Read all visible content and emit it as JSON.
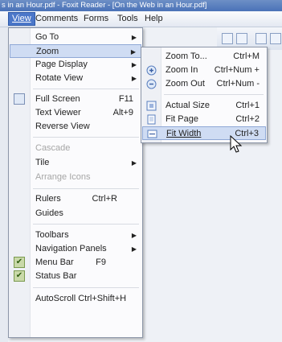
{
  "window": {
    "title": "s in an Hour.pdf - Foxit Reader - [On the Web in an Hour.pdf]"
  },
  "menubar": {
    "items": [
      {
        "label": "View",
        "active": true
      },
      {
        "label": "Comments"
      },
      {
        "label": "Forms"
      },
      {
        "label": "Tools"
      },
      {
        "label": "Help"
      }
    ]
  },
  "view_menu": {
    "items": [
      {
        "label": "Go To",
        "submenu": true
      },
      {
        "label": "Zoom",
        "submenu": true,
        "highlighted": true
      },
      {
        "label": "Page Display",
        "submenu": true
      },
      {
        "label": "Rotate View",
        "submenu": true
      },
      {
        "label": "Full Screen",
        "shortcut": "F11",
        "icon": "full-screen-icon"
      },
      {
        "label": "Text Viewer",
        "shortcut": "Alt+9"
      },
      {
        "label": "Reverse View"
      },
      {
        "label": "Cascade",
        "disabled": true
      },
      {
        "label": "Tile",
        "submenu": true
      },
      {
        "label": "Arrange Icons",
        "disabled": true
      },
      {
        "label": "Rulers",
        "shortcut": "Ctrl+R"
      },
      {
        "label": "Guides"
      },
      {
        "label": "Toolbars",
        "submenu": true
      },
      {
        "label": "Navigation Panels",
        "submenu": true
      },
      {
        "label": "Menu Bar",
        "shortcut": "F9",
        "checked": true
      },
      {
        "label": "Status Bar",
        "checked": true
      },
      {
        "label": "AutoScroll Ctrl+Shift+H"
      }
    ]
  },
  "zoom_submenu": {
    "items": [
      {
        "label": "Zoom To...",
        "shortcut": "Ctrl+M"
      },
      {
        "label": "Zoom In",
        "shortcut": "Ctrl+Num +",
        "icon": "zoom-in-icon"
      },
      {
        "label": "Zoom Out",
        "shortcut": "Ctrl+Num -",
        "icon": "zoom-out-icon"
      },
      {
        "label": "Actual Size",
        "shortcut": "Ctrl+1",
        "icon": "actual-size-icon"
      },
      {
        "label": "Fit Page",
        "shortcut": "Ctrl+2",
        "icon": "fit-page-icon"
      },
      {
        "label": "Fit Width",
        "shortcut": "Ctrl+3",
        "icon": "fit-width-icon",
        "highlighted": true
      }
    ]
  },
  "colors": {
    "accent": "#4b77c9",
    "highlight": "#cfdcf3"
  }
}
